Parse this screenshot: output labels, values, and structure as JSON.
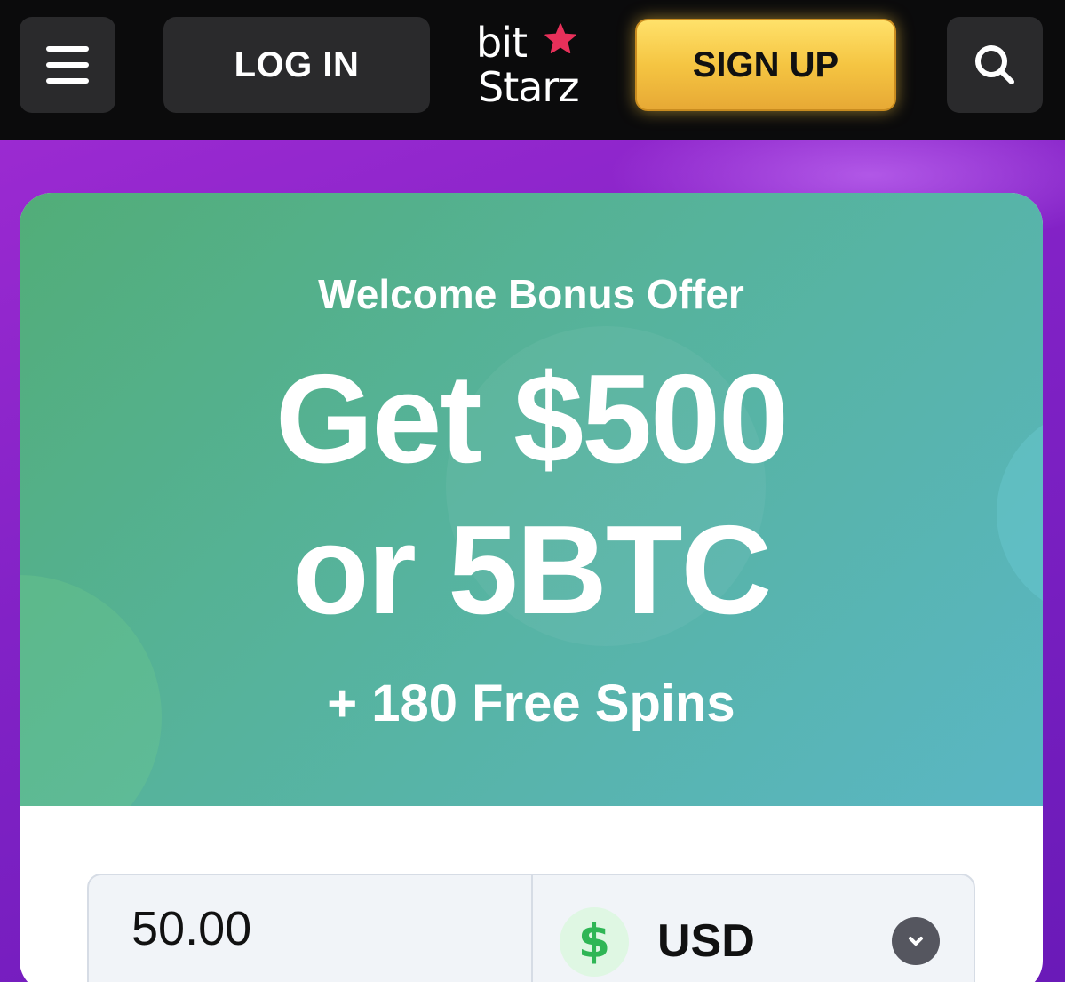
{
  "header": {
    "login_label": "LOG IN",
    "signup_label": "SIGN UP",
    "logo": {
      "line1": "bit",
      "line2": "Starz"
    }
  },
  "banner": {
    "kicker": "Welcome Bonus Offer",
    "headline_line1": "Get $500",
    "headline_line2": "or 5BTC",
    "subline": "+ 180 Free Spins"
  },
  "deposit": {
    "amount_value": "50.00",
    "currency": {
      "symbol": "$",
      "code": "USD"
    }
  },
  "icons": {
    "menu": "hamburger-icon",
    "search": "search-icon",
    "logo_star": "star-icon",
    "currency": "dollar-icon",
    "dropdown": "chevron-down-icon"
  },
  "colors": {
    "header_bg": "#0b0b0c",
    "button_dark": "#2a2a2c",
    "signup_gold": "#f5c542",
    "logo_star": "#e8305a",
    "page_purple": "#8222c6",
    "banner_green": "#52ad78",
    "banner_teal": "#5ab6c4",
    "dollar_green": "#2fb655"
  }
}
